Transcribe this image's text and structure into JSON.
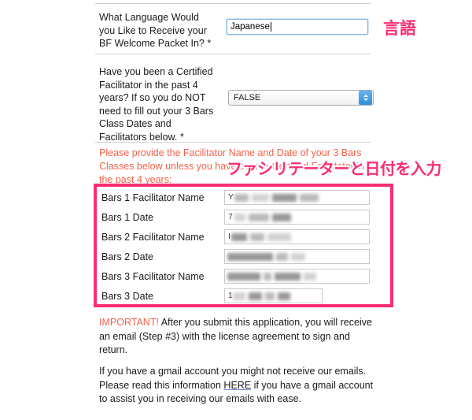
{
  "form": {
    "questions": [
      {
        "label": "What Language Would you Like to Receive your BF Welcome Packet In? *",
        "control": "text",
        "value": "Japanese"
      },
      {
        "label": "Have you been a Certified Facilitator in the past 4 years? If so you do NOT need to fill out your 3 Bars Class Dates and Facilitators below. *",
        "control": "select",
        "value": "FALSE"
      }
    ],
    "red_instruction": "Please provide the Facilitator Name and Date of your 3 Bars Classes below unless you have been a Certified Facilitator in the past 4 years:",
    "bars_rows": [
      {
        "label": "Bars 1 Facilitator Name",
        "value": "",
        "redacted": true,
        "width": "wide"
      },
      {
        "label": "Bars 1 Date",
        "value": "",
        "redacted": true,
        "width": "wide"
      },
      {
        "label": "Bars 2 Facilitator Name",
        "value": "",
        "redacted": true,
        "width": "wide"
      },
      {
        "label": "Bars 2 Date",
        "value": "",
        "redacted": true,
        "width": "wide"
      },
      {
        "label": "Bars 3 Facilitator Name",
        "value": "",
        "redacted": true,
        "width": "wide"
      },
      {
        "label": "Bars 3 Date",
        "value": "",
        "redacted": true,
        "width": "narrow"
      }
    ]
  },
  "notices": {
    "important_keyword": "IMPORTANT!",
    "important_text": "  After you submit this application, you will receive an email (Step #3) with the license agreement to sign and return.",
    "gmail_part1": "If you have a gmail account you might not receive our emails.  Please read this information ",
    "gmail_link": "HERE",
    "gmail_part2": " if you have a gmail account to assist you in receiving our emails with ease."
  },
  "annotations": [
    {
      "text": "言語",
      "name": "annotation-language"
    },
    {
      "text": "ファシリテーターと日付を入力",
      "name": "annotation-facilitator-date"
    }
  ],
  "colors": {
    "highlight_pink": "#fb2d71",
    "instruction_red": "#f4624a",
    "focus_blue": "#7eb4e2"
  }
}
